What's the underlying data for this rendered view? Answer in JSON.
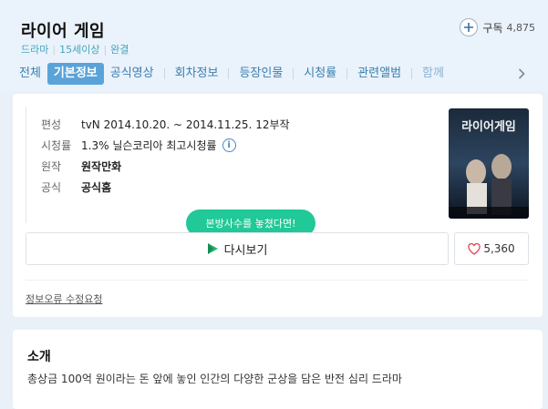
{
  "header": {
    "title": "라이어 게임",
    "meta": [
      "드라마",
      "15세이상",
      "완결"
    ],
    "subscribe_label": "구독",
    "subscribe_count": "4,875"
  },
  "tabs": [
    "전체",
    "기본정보",
    "공식영상",
    "회차정보",
    "등장인물",
    "시청률",
    "관련앨범",
    "함께"
  ],
  "active_tab": "기본정보",
  "info": {
    "broadcast_label": "편성",
    "channel": "tvN",
    "period": "2014.10.20. ~ 2014.11.25.",
    "episodes": "12부작",
    "rating_label": "시청률",
    "rating_value": "1.3%",
    "rating_source": "닐슨코리아 최고시청률",
    "original_label": "원작",
    "original_value": "원작만화",
    "official_label": "공식",
    "official_value": "공식홈"
  },
  "tooltip": "본방사수를 놓쳤다면!",
  "replay_label": "다시보기",
  "like_count": "5,360",
  "report_link": "정보오류 수정요청",
  "about": {
    "title": "소개",
    "text": "총상금 100억 원이라는 돈 앞에 놓인 인간의 다양한 군상을 담은 반전 심리 드라마"
  },
  "poster": {
    "title_text": "라이어게임",
    "image_subject": "drama poster"
  },
  "colors": {
    "accent_blue": "#5aa3d8",
    "meta_teal": "#43a5bd",
    "green": "#1aa11a",
    "red": "#e0454f",
    "tooltip_green": "#20c997"
  },
  "icons": [
    "plus-icon",
    "info-icon",
    "play-icon",
    "heart-icon",
    "chevron-right-icon"
  ]
}
